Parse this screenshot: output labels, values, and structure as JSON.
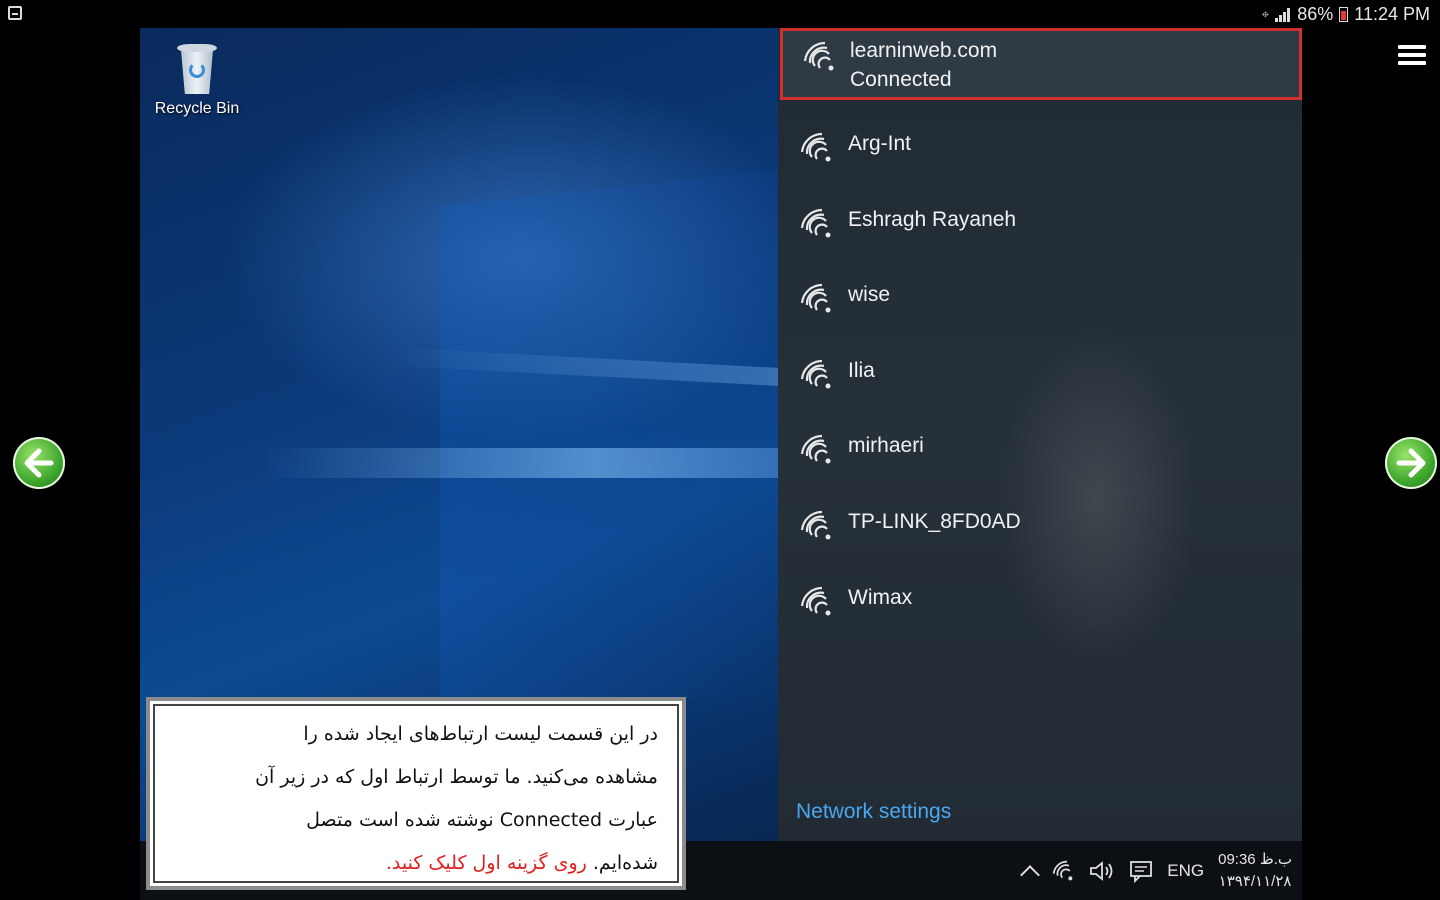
{
  "status_bar": {
    "battery": "86%",
    "time": "11:24 PM",
    "icons": [
      "notification-icon",
      "wifi-off-icon",
      "signal-icon",
      "battery-icon"
    ]
  },
  "desktop": {
    "recycle_bin_label": "Recycle Bin"
  },
  "network_flyout": {
    "connected": {
      "name": "learninweb.com",
      "status": "Connected"
    },
    "networks": [
      "Arg-Int",
      "Eshragh Rayaneh",
      "wise",
      "Ilia",
      "mirhaeri",
      "TP-LINK_8FD0AD",
      "Wimax"
    ],
    "settings_link": "Network settings"
  },
  "taskbar": {
    "language": "ENG",
    "time": "09:36 ب.ظ",
    "date": "۱۳۹۴/۱۱/۲۸"
  },
  "caption": {
    "line1": "در این قسمت لیست ارتباط‌های ایجاد شده را",
    "line2": "مشاهده می‌کنید. ما توسط ارتباط اول که در زیر آن",
    "line3": "عبارت Connected نوشته شده است متصل",
    "line4_black": "شده‌ایم.",
    "line4_red": "روی گزینه اول کلیک کنید."
  },
  "colors": {
    "highlight_border": "#d32f2f",
    "link": "#4aa8f0",
    "caption_red": "#e02020",
    "nav_arrow": "#3aa42a"
  }
}
